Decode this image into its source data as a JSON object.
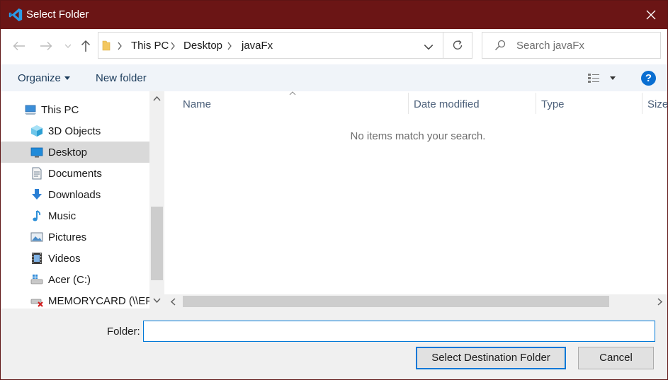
{
  "titlebar": {
    "title": "Select Folder",
    "app_icon": "vscode-icon",
    "close_icon": "close-icon",
    "color": "#6b1515"
  },
  "navigation": {
    "back_icon": "arrow-left-icon",
    "forward_icon": "arrow-right-icon",
    "recent_icon": "chevron-down-icon",
    "up_icon": "arrow-up-icon"
  },
  "address": {
    "breadcrumbs": [
      "This PC",
      "Desktop",
      "javaFx"
    ],
    "refresh_icon": "refresh-icon"
  },
  "search": {
    "placeholder": "Search javaFx"
  },
  "toolbar": {
    "organize": "Organize",
    "new_folder": "New folder",
    "view_icon": "view-list-icon",
    "help": "?"
  },
  "nav_pane": {
    "items": [
      {
        "label": "This PC",
        "icon": "computer-icon"
      },
      {
        "label": "3D Objects",
        "icon": "3d-objects-icon"
      },
      {
        "label": "Desktop",
        "icon": "desktop-icon",
        "selected": true
      },
      {
        "label": "Documents",
        "icon": "documents-icon"
      },
      {
        "label": "Downloads",
        "icon": "downloads-icon"
      },
      {
        "label": "Music",
        "icon": "music-icon"
      },
      {
        "label": "Pictures",
        "icon": "pictures-icon"
      },
      {
        "label": "Videos",
        "icon": "videos-icon"
      },
      {
        "label": "Acer (C:)",
        "icon": "drive-icon"
      },
      {
        "label": "MEMORYCARD (\\\\EPS",
        "icon": "network-drive-disconnected-icon"
      }
    ]
  },
  "file_list": {
    "columns": [
      "Name",
      "Date modified",
      "Type",
      "Size"
    ],
    "empty_message": "No items match your search."
  },
  "bottom": {
    "folder_label": "Folder:",
    "folder_value": "",
    "select_button": "Select Destination Folder",
    "cancel_button": "Cancel"
  }
}
